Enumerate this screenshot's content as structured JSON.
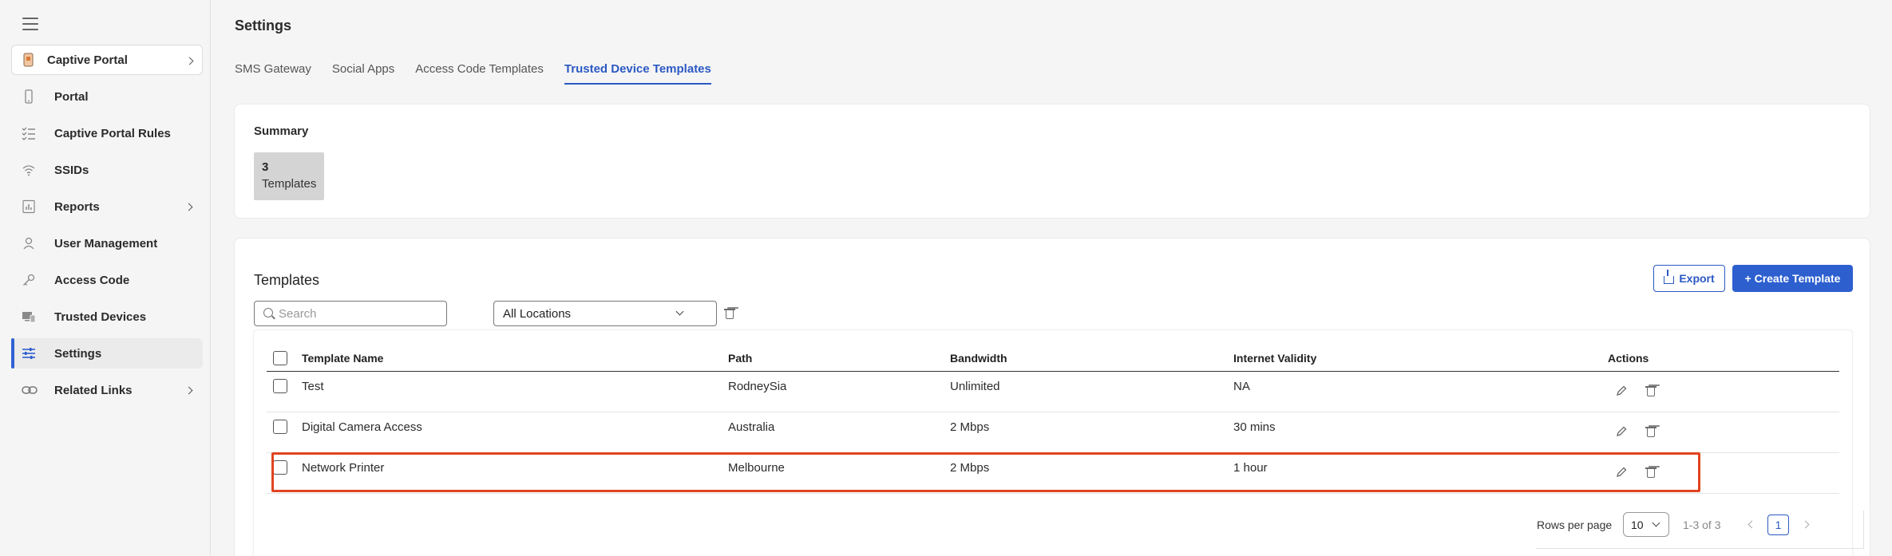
{
  "sidebar": {
    "module": {
      "label": "Captive Portal",
      "icon": "captive-portal-icon"
    },
    "items": [
      {
        "label": "Portal",
        "icon": "phone-icon"
      },
      {
        "label": "Captive Portal Rules",
        "icon": "checklist-icon"
      },
      {
        "label": "SSIDs",
        "icon": "wifi-icon"
      },
      {
        "label": "Reports",
        "icon": "bar-chart-icon"
      },
      {
        "label": "User Management",
        "icon": "user-icon"
      },
      {
        "label": "Access Code",
        "icon": "key-icon"
      },
      {
        "label": "Trusted Devices",
        "icon": "devices-icon"
      },
      {
        "label": "Settings",
        "icon": "sliders-icon",
        "active": true
      },
      {
        "label": "Related Links",
        "icon": "link-icon"
      }
    ]
  },
  "header": {
    "title": "Settings"
  },
  "tabs": [
    {
      "label": "SMS Gateway"
    },
    {
      "label": "Social Apps"
    },
    {
      "label": "Access Code Templates"
    },
    {
      "label": "Trusted Device Templates",
      "active": true
    }
  ],
  "summary": {
    "title": "Summary",
    "count": "3",
    "count_label": "Templates"
  },
  "templates": {
    "title": "Templates",
    "search_placeholder": "Search",
    "location_filter": "All Locations",
    "export_label": "Export",
    "create_label": "+ Create Template",
    "columns": [
      "Template Name",
      "Path",
      "Bandwidth",
      "Internet Validity",
      "Actions"
    ],
    "rows": [
      {
        "name": "Test",
        "path": "RodneySia",
        "bandwidth": "Unlimited",
        "validity": "NA"
      },
      {
        "name": "Digital Camera Access",
        "path": "Australia",
        "bandwidth": "2 Mbps",
        "validity": "30 mins"
      },
      {
        "name": "Network Printer",
        "path": "Melbourne",
        "bandwidth": "2 Mbps",
        "validity": "1 hour",
        "highlighted": true
      }
    ]
  },
  "pagination": {
    "rows_per_page_label": "Rows per page",
    "rows_per_page": "10",
    "range": "1-3 of 3",
    "current_page": "1"
  },
  "colors": {
    "accent": "#2b59c3",
    "highlight": "#e0441f",
    "active_bar": "#3062d4"
  }
}
